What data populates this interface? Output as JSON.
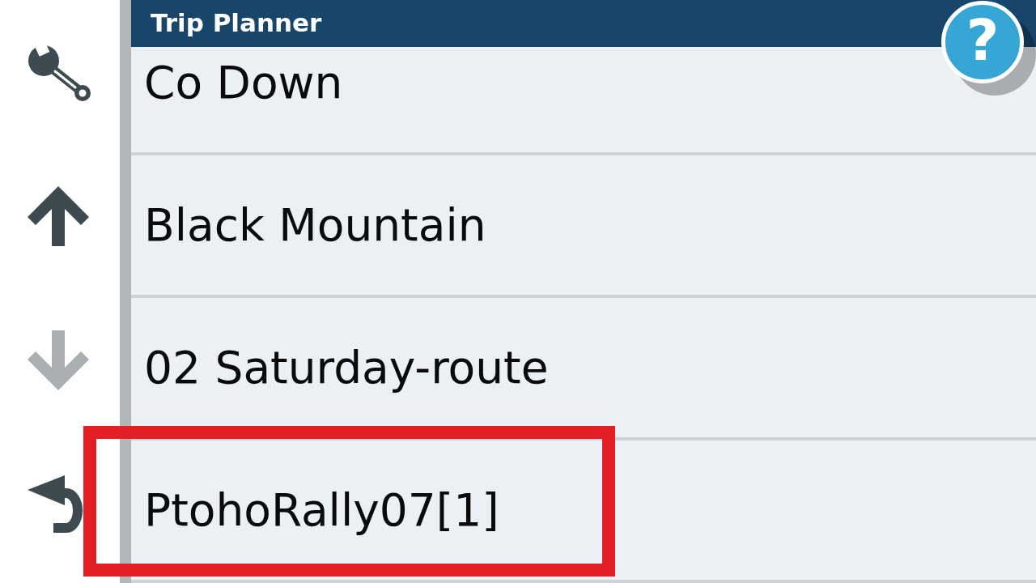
{
  "sidebar": {
    "buttons": [
      {
        "kind": "settings",
        "disabled": false
      },
      {
        "kind": "scroll_up",
        "disabled": false
      },
      {
        "kind": "scroll_down",
        "disabled": true
      },
      {
        "kind": "back",
        "disabled": false
      }
    ]
  },
  "header": {
    "title": "Trip Planner"
  },
  "help_button": {
    "label": "?"
  },
  "routes": [
    {
      "name": "Co Down",
      "highlighted": false
    },
    {
      "name": "Black Mountain",
      "highlighted": false
    },
    {
      "name": "02 Saturday-route",
      "highlighted": false
    },
    {
      "name": "PtohoRally07[1]",
      "highlighted": true
    }
  ]
}
